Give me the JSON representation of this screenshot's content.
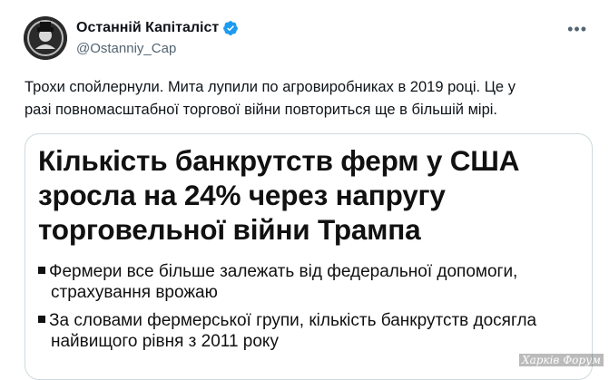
{
  "author": {
    "display_name": "Останній Капіталіст",
    "handle": "@Ostanniy_Cap",
    "verified_icon": "verified-badge-icon",
    "avatar_icon": "avatar"
  },
  "more_icon": "more-horizontal-icon",
  "tweet": {
    "line1": "Трохи спойлернули. Мита лупили по агровиробниках в 2019 році. Це у",
    "line2": "разі повномасштабної торгової війни повториться ще в більшій мірі."
  },
  "media": {
    "headline_line1": "Кількість банкрутств ферм у США",
    "headline_line2": "зросла на 24% через напругу",
    "headline_line3": "торговельної війни Трампа",
    "bullet1_line1": "Фермери все більше залежать від федеральної допомоги,",
    "bullet1_line2": "страхування врожаю",
    "bullet2_line1": "За словами фермерської групи, кількість банкрутств досягла",
    "bullet2_line2": "найвищого рівня з 2011 року"
  },
  "watermark": "Харків Форум",
  "colors": {
    "verified": "#1d9bf0",
    "handle": "#536471",
    "border": "#cfd9de"
  }
}
